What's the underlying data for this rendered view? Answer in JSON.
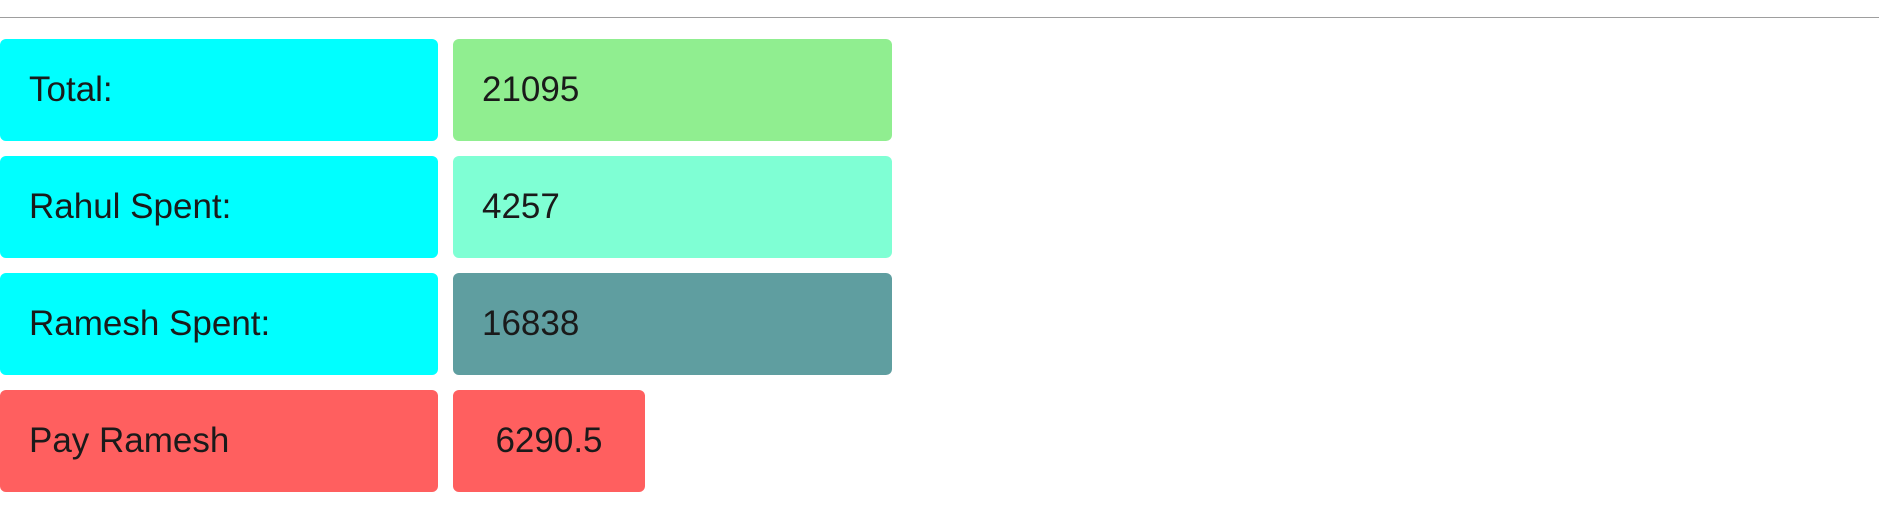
{
  "colors": {
    "label_bg": "#00ffff",
    "total_value_bg": "#90ee90",
    "rahul_value_bg": "#7fffd4",
    "ramesh_value_bg": "#5f9ea0",
    "pay_bg": "#ff5f5f",
    "rule": "#9e9e9e"
  },
  "summary": {
    "total": {
      "label": "Total:",
      "value": "21095"
    },
    "rahul": {
      "label": "Rahul Spent:",
      "value": "4257"
    },
    "ramesh": {
      "label": "Ramesh Spent:",
      "value": "16838"
    },
    "settlement": {
      "label": "Pay Ramesh",
      "value": "6290.5"
    }
  }
}
